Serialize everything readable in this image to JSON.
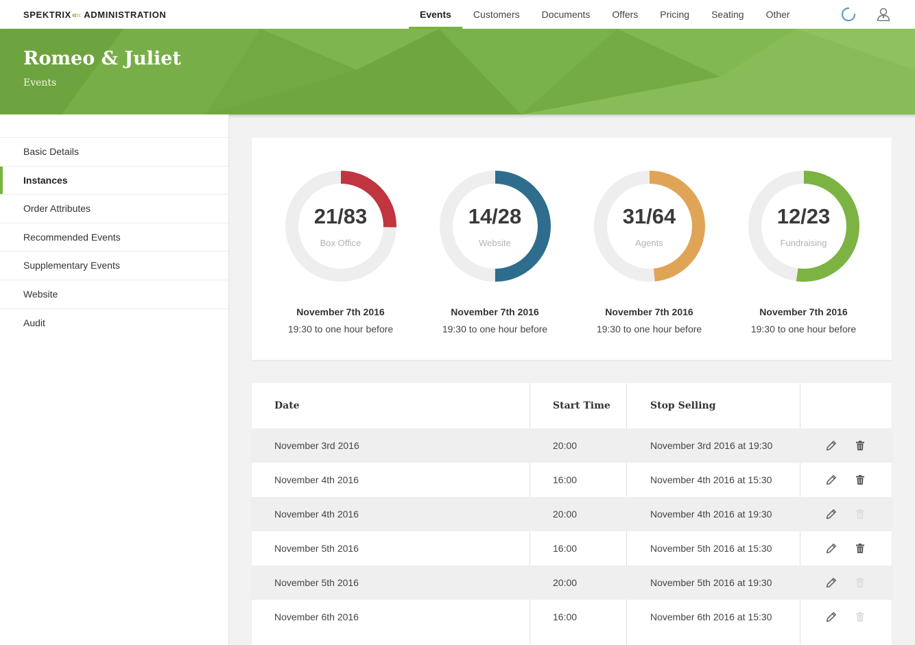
{
  "brand": {
    "name": "SPEKTRIX",
    "mark": "«",
    "section": "ADMINISTRATION"
  },
  "nav": {
    "items": [
      {
        "label": "Events",
        "active": true
      },
      {
        "label": "Customers",
        "active": false
      },
      {
        "label": "Documents",
        "active": false
      },
      {
        "label": "Offers",
        "active": false
      },
      {
        "label": "Pricing",
        "active": false
      },
      {
        "label": "Seating",
        "active": false
      },
      {
        "label": "Other",
        "active": false
      }
    ],
    "icons": [
      "loading-spinner-icon",
      "user-account-icon"
    ]
  },
  "banner": {
    "title": "Romeo & Juliet",
    "subtitle": "Events",
    "color": "#76ad45"
  },
  "sidebar": {
    "items": [
      {
        "label": "Basic Details",
        "active": false
      },
      {
        "label": "Instances",
        "active": true
      },
      {
        "label": "Order Attributes",
        "active": false
      },
      {
        "label": "Recommended Events",
        "active": false
      },
      {
        "label": "Supplementary Events",
        "active": false
      },
      {
        "label": "Website",
        "active": false
      },
      {
        "label": "Audit",
        "active": false
      }
    ]
  },
  "allocations": [
    {
      "sold": 21,
      "total": 83,
      "value_text": "21/83",
      "label": "Box Office",
      "color": "#c0353f",
      "date": "November 7th 2016",
      "time": "19:30 to one hour before"
    },
    {
      "sold": 14,
      "total": 28,
      "value_text": "14/28",
      "label": "Website",
      "color": "#2e6d8e",
      "date": "November 7th 2016",
      "time": "19:30 to one hour before"
    },
    {
      "sold": 31,
      "total": 64,
      "value_text": "31/64",
      "label": "Agents",
      "color": "#e0a457",
      "date": "November 7th 2016",
      "time": "19:30 to one hour before"
    },
    {
      "sold": 12,
      "total": 23,
      "value_text": "12/23",
      "label": "Fundraising",
      "color": "#7cb342",
      "date": "November 7th 2016",
      "time": "19:30 to one hour before"
    }
  ],
  "instances": {
    "columns": [
      "Date",
      "Start Time",
      "Stop Selling",
      ""
    ],
    "rows": [
      {
        "date": "November 3rd 2016",
        "start": "20:00",
        "stop": "November 3rd 2016 at 19:30",
        "delete_enabled": true
      },
      {
        "date": "November 4th 2016",
        "start": "16:00",
        "stop": "November 4th 2016 at 15:30",
        "delete_enabled": true
      },
      {
        "date": "November 4th 2016",
        "start": "20:00",
        "stop": "November 4th 2016 at 19:30",
        "delete_enabled": false
      },
      {
        "date": "November 5th 2016",
        "start": "16:00",
        "stop": "November 5th 2016 at 15:30",
        "delete_enabled": true
      },
      {
        "date": "November 5th 2016",
        "start": "20:00",
        "stop": "November 5th 2016 at 19:30",
        "delete_enabled": false
      },
      {
        "date": "November 6th 2016",
        "start": "16:00",
        "stop": "November 6th 2016 at 15:30",
        "delete_enabled": false
      }
    ],
    "row_icons": [
      "edit-pencil-icon",
      "delete-trash-icon"
    ]
  }
}
